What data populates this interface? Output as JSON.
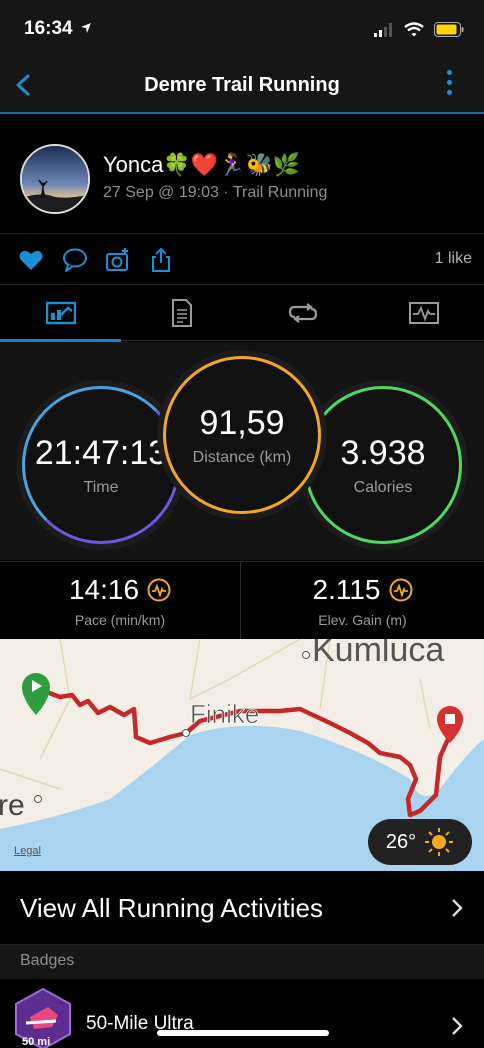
{
  "status": {
    "time": "16:34"
  },
  "nav": {
    "title": "Demre Trail Running"
  },
  "profile": {
    "name": "Yonca🍀❤️🏃‍♀️🐝🌿",
    "meta": "27 Sep @ 19:03 · Trail Running"
  },
  "actions": {
    "likes": "1 like"
  },
  "metrics": {
    "time": {
      "value": "21:47:13",
      "label": "Time"
    },
    "distance": {
      "value": "91,59",
      "label": "Distance (km)"
    },
    "calories": {
      "value": "3.938",
      "label": "Calories"
    },
    "pace": {
      "value": "14:16",
      "label": "Pace (min/km)"
    },
    "elevation": {
      "value": "2.115",
      "label": "Elev. Gain (m)"
    }
  },
  "map": {
    "place_label": "Finike",
    "place_partial_top": "Kumluca",
    "place_partial_left": "re",
    "legal": "Legal",
    "temperature": "26°"
  },
  "view_all": {
    "label": "View All Running Activities"
  },
  "badges": {
    "header": "Badges",
    "item_label": "50-Mile Ultra",
    "badge_text": "50 mi"
  },
  "colors": {
    "accent": "#1a8fd6",
    "time_ring": "#4aa3e0",
    "distance_ring": "#f5a623",
    "calories_ring": "#4cd964",
    "route": "#c62828",
    "water": "#a9d4ef",
    "land": "#f3efe6"
  }
}
